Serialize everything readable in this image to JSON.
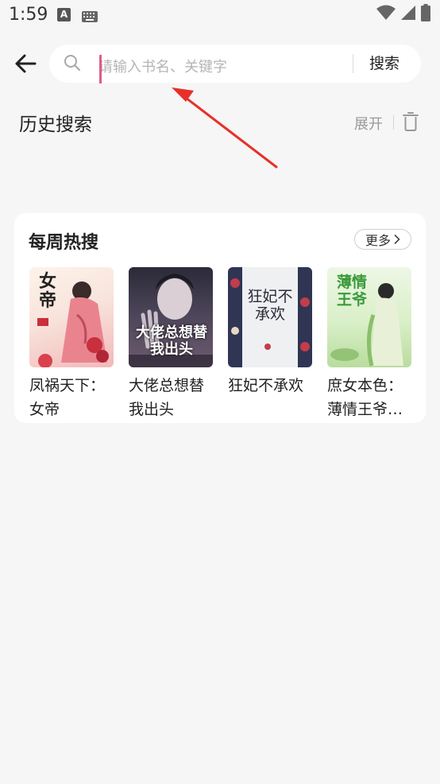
{
  "status_bar": {
    "time": "1:59",
    "notification_icon": "A"
  },
  "search": {
    "placeholder": "请输入书名、关键字",
    "submit_label": "搜索"
  },
  "history": {
    "title": "历史搜索",
    "expand_label": "展开"
  },
  "weekly_hot": {
    "title": "每周热搜",
    "more_label": "更多",
    "books": [
      {
        "title": "凤祸天下：女帝",
        "cover_text": "女帝"
      },
      {
        "title": "大佬总想替我出头",
        "cover_text": "大佬总想替我出头"
      },
      {
        "title": "狂妃不承欢",
        "cover_text": "狂妃不承欢"
      },
      {
        "title": "庶女本色：薄情王爷…",
        "cover_text": "薄情王爷"
      }
    ]
  },
  "colors": {
    "accent": "#e25a8a",
    "arrow": "#e8302a"
  }
}
